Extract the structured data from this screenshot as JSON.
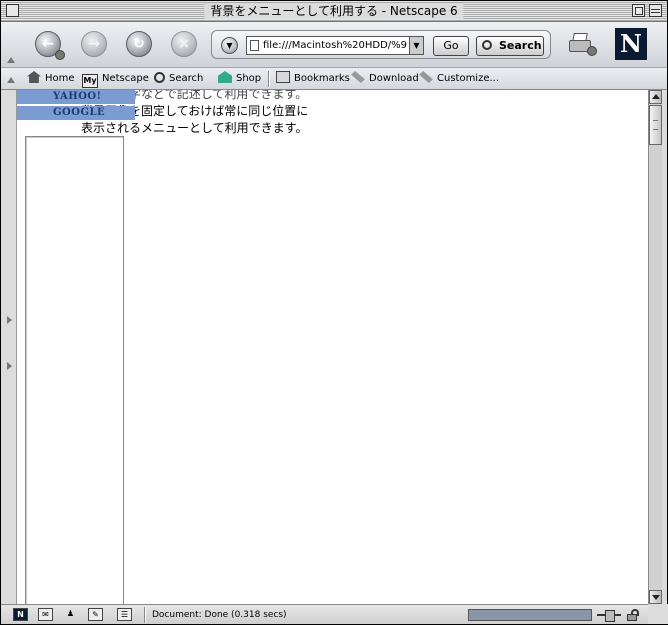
{
  "window": {
    "title": "背景をメニューとして利用する - Netscape 6"
  },
  "navbar": {
    "url": "file:///Macintosh%20HDD/%9",
    "go_label": "Go",
    "search_label": "Search",
    "logo_letter": "N"
  },
  "personal_toolbar": {
    "items": [
      {
        "label": "Home",
        "icon": "home-icon"
      },
      {
        "label": "Netscape",
        "icon": "my-netscape-icon",
        "icon_text": "My"
      },
      {
        "label": "Search",
        "icon": "search-icon"
      },
      {
        "label": "Shop",
        "icon": "shop-icon"
      },
      {
        "label": "Bookmarks",
        "icon": "folder-icon"
      },
      {
        "label": "Download",
        "icon": "tag-icon"
      },
      {
        "label": "Customize...",
        "icon": "tag-icon"
      }
    ]
  },
  "content": {
    "menu_links": [
      "YAHOO!",
      "GOOGLE"
    ],
    "lines": [
      "ールに文字などで記述して利用できます。",
      "背景画像を固定しておけば常に同じ位置に",
      "表示されるメニューとして利用できます。"
    ]
  },
  "statusbar": {
    "text": "Document: Done (0.318 secs)",
    "nav_icon_letter": "N"
  },
  "colors": {
    "menu_background": "#7b9cd0",
    "menu_text": "#1a3a7a",
    "progress_fill": "#8a96a8"
  }
}
